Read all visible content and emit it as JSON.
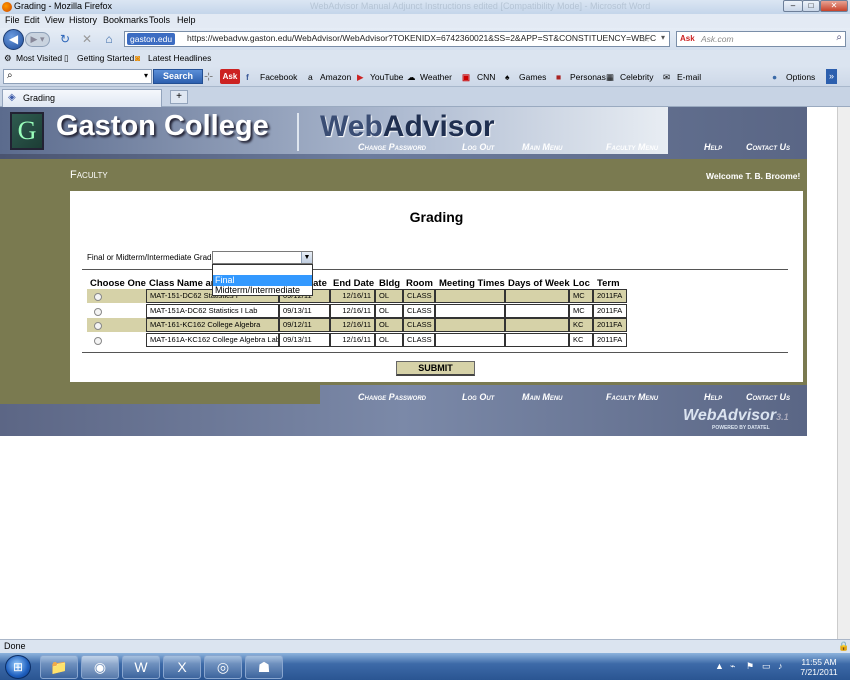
{
  "window": {
    "title": "Grading - Mozilla Firefox",
    "blurred_title": "WebAdvisor Manual Adjunct Instructions edited [Compatibility Mode] - Microsoft Word",
    "min": "–",
    "max": "□",
    "close": "✕"
  },
  "menubar": [
    "File",
    "Edit",
    "View",
    "History",
    "Bookmarks",
    "Tools",
    "Help"
  ],
  "navbar": {
    "back_icon": "back-arrow-icon",
    "site_badge": "gaston.edu",
    "url": "https://webadvw.gaston.edu/WebAdvisor/WebAdvisor?TOKENIDX=6742360021&SS=2&APP=ST&CONSTITUENCY=WBFC",
    "search_placeholder": "Ask.com"
  },
  "bookmarks": [
    "Most Visited",
    "Getting Started",
    "Latest Headlines"
  ],
  "toolbar": {
    "search_button": "Search",
    "items": [
      "Facebook",
      "Amazon",
      "YouTube",
      "Weather",
      "CNN",
      "Games",
      "Personas",
      "Celebrity",
      "E-mail"
    ],
    "options": "Options"
  },
  "tab": {
    "label": "Grading",
    "new_tab": "+"
  },
  "header": {
    "logo_letter": "G",
    "college": "Gaston College",
    "webadvisor_a": "Web",
    "webadvisor_b": "Advisor",
    "links": [
      "Change Password",
      "Log Out",
      "Main Menu",
      "Faculty Menu",
      "Help",
      "Contact Us"
    ]
  },
  "band": {
    "section": "Faculty",
    "welcome": "Welcome T. B. Broome!"
  },
  "page": {
    "heading": "Grading",
    "grade_label": "Final or Midterm/Intermediate Grading",
    "grade_options": [
      "Final",
      "Midterm/Intermediate"
    ],
    "submit": "SUBMIT"
  },
  "table": {
    "headers": [
      "Choose One",
      "Class Name and Title",
      "Start Date",
      "End Date",
      "Bldg",
      "Room",
      "Meeting Times",
      "Days of Week",
      "Loc",
      "Term"
    ],
    "rows": [
      {
        "name": "MAT-151-DC62 Statistics I",
        "start": "09/12/11",
        "end": "12/16/11",
        "bldg": "OL",
        "room": "CLASS",
        "times": "",
        "days": "",
        "loc": "MC",
        "term": "2011FA",
        "shaded": true
      },
      {
        "name": "MAT-151A-DC62 Statistics I Lab",
        "start": "09/13/11",
        "end": "12/16/11",
        "bldg": "OL",
        "room": "CLASS",
        "times": "",
        "days": "",
        "loc": "MC",
        "term": "2011FA",
        "shaded": false
      },
      {
        "name": "MAT-161-KC162 College Algebra",
        "start": "09/12/11",
        "end": "12/16/11",
        "bldg": "OL",
        "room": "CLASS",
        "times": "",
        "days": "",
        "loc": "KC",
        "term": "2011FA",
        "shaded": true
      },
      {
        "name": "MAT-161A-KC162 College Algebra Lab",
        "start": "09/13/11",
        "end": "12/16/11",
        "bldg": "OL",
        "room": "CLASS",
        "times": "",
        "days": "",
        "loc": "KC",
        "term": "2011FA",
        "shaded": false
      }
    ]
  },
  "footer": {
    "logo": "WebAdvisor",
    "version": "3.1",
    "powered": "POWERED BY DATATEL"
  },
  "status": "Done",
  "taskbar": {
    "time": "11:55 AM",
    "date": "7/21/2011"
  },
  "colors": {
    "olive": "#7a7a50",
    "row_shaded": "#d6d2a8",
    "header_blue": "#5c6685"
  }
}
